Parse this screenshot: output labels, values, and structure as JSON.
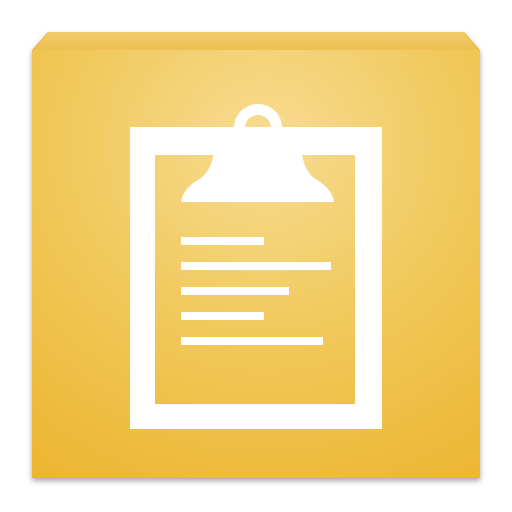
{
  "icon": {
    "name": "clipboard-notes-app-icon",
    "symbol": "clipboard-icon",
    "tile_color_center": "#F6D98A",
    "tile_color_edge": "#EDB834",
    "tile_bevel_top": "#F4CF6E",
    "tile_bevel_side": "#E5AE2C",
    "glyph_color": "#FFFFFF",
    "text_line_count": 5
  }
}
